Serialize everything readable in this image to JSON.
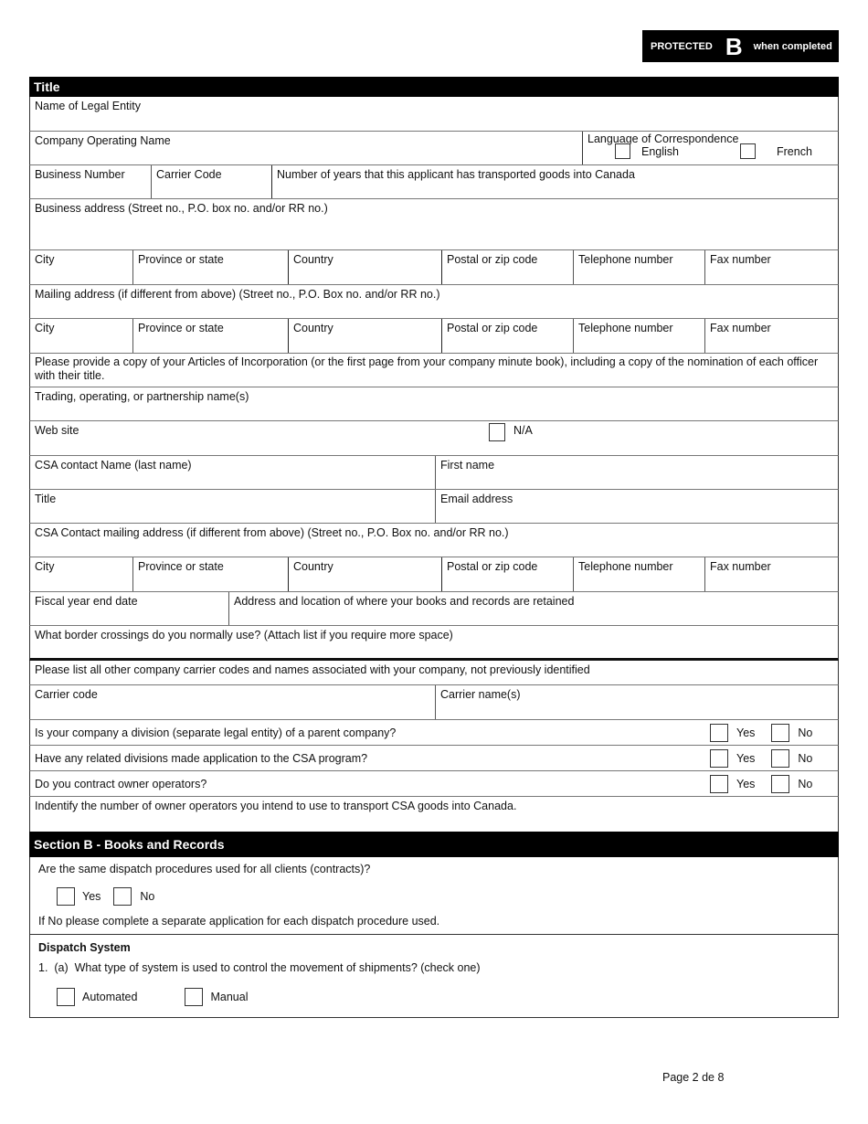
{
  "badge": {
    "protected": "PROTECTED",
    "level": "B",
    "suffix": "when completed"
  },
  "section_a": {
    "title": "Title",
    "legal_entity": "Name of Legal Entity",
    "operating_name": "Company Operating Name",
    "language": {
      "label": "Language of Correspondence",
      "english": "English",
      "french": "French"
    },
    "business_number": "Business Number",
    "carrier_code": "Carrier Code",
    "years_transported": "Number of years that this applicant has transported goods into Canada",
    "business_address": "Business address (Street no., P.O. box no. and/or RR no.)",
    "address_cols": [
      "City",
      "Province or state",
      "Country",
      "Postal or zip code",
      "Telephone number",
      "Fax number"
    ],
    "mailing_address": "Mailing address (if different from above) (Street no., P.O. Box no. and/or RR no.)",
    "articles_note": "Please provide a copy of your Articles of Incorporation (or the first page from your company minute book), including a copy of the nomination of each officer with their title.",
    "trading_names": "Trading, operating, or partnership name(s)",
    "website": "Web site",
    "website_na": "N/A",
    "csa_last_name": "CSA contact Name (last name)",
    "first_name": "First name",
    "email": "Email address",
    "csa_mailing": "CSA Contact mailing address (if different from above) (Street no., P.O. Box no. and/or RR no.)",
    "fiscal_year": "Fiscal year end date",
    "books_location": "Address and location of where your books and records are retained",
    "border_crossings": "What border crossings do you normally use? (Attach list if you require more space)",
    "other_carriers": "Please list all other company carrier codes and names associated with your company, not previously identified",
    "carrier_code_col": "Carrier code",
    "carrier_names_col": "Carrier name(s)",
    "questions": [
      {
        "text": "Is your company a division (separate legal entity) of a parent company?",
        "yes": "Yes",
        "no": "No"
      },
      {
        "text": "Have any related divisions made application to the CSA program?",
        "yes": "Yes",
        "no": "No"
      },
      {
        "text": "Do you contract owner operators?",
        "yes": "Yes",
        "no": "No"
      }
    ],
    "owner_operators": "Indentify the number of owner operators you intend to use to transport CSA goods into Canada."
  },
  "section_b": {
    "title": "Section B - Books and Records",
    "dispatch_question": "Are the same dispatch procedures used for all clients (contracts)?",
    "yes": "Yes",
    "no": "No",
    "if_no": "If No please complete a separate application for each dispatch procedure used.",
    "dispatch_heading": "Dispatch System",
    "q1a": "1.  (a)  What type of system is used to control the movement of shipments? (check one)",
    "automated": "Automated",
    "manual": "Manual"
  },
  "footer": {
    "page": "Page 2 de 8"
  }
}
